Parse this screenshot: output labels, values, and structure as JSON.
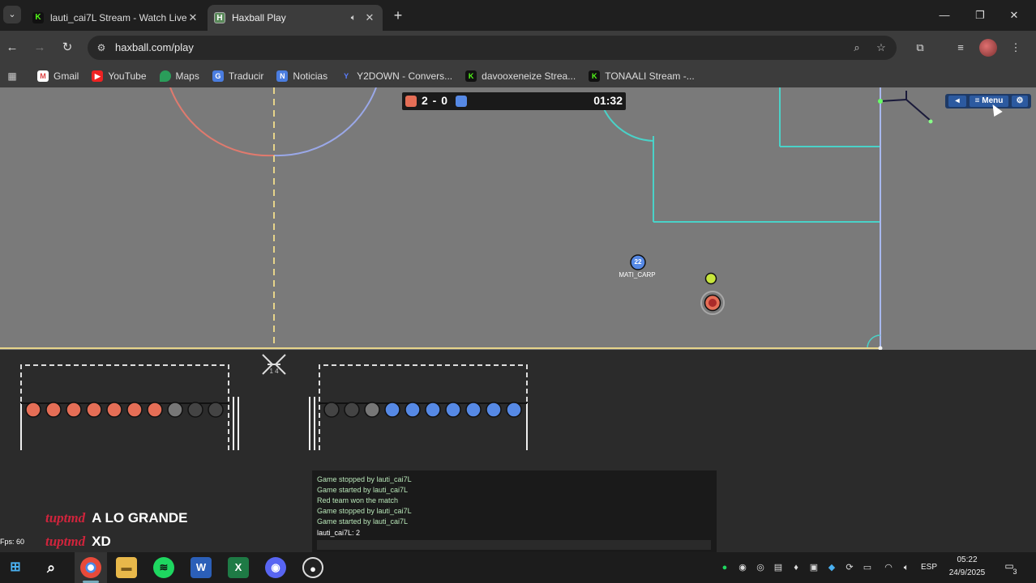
{
  "browser": {
    "tabs": [
      {
        "title": "lauti_cai7L Stream - Watch Live",
        "favicon": "K",
        "active": false
      },
      {
        "title": "Haxball Play",
        "favicon": "H",
        "active": true
      }
    ],
    "url": "haxball.com/play",
    "bookmarks": [
      {
        "label": "Gmail",
        "icon": "M"
      },
      {
        "label": "YouTube",
        "icon": "▶"
      },
      {
        "label": "Maps",
        "icon": "●"
      },
      {
        "label": "Traducir",
        "icon": "G"
      },
      {
        "label": "Noticias",
        "icon": "N"
      },
      {
        "label": "Y2DOWN - Convers...",
        "icon": "Y"
      },
      {
        "label": "davooxeneize Strea...",
        "icon": "K"
      },
      {
        "label": "TONAALI Stream -...",
        "icon": "K"
      }
    ]
  },
  "game": {
    "score": "2 - 0",
    "timer": "01:32",
    "menu_label": "≡ Menu",
    "player_name": "MATI_CARP",
    "player_number": "22",
    "goal_score_label": "1 4",
    "team_colors": {
      "red": "#e56e56",
      "blue": "#5689e5"
    },
    "fps_label": "Fps: 60"
  },
  "chat": {
    "lines": [
      "Game stopped by lauti_cai7L",
      "Game started by lauti_cai7L",
      "Red team won the match",
      "Game stopped by lauti_cai7L",
      "Game started by lauti_cai7L",
      "lauti_cai7L: 2"
    ]
  },
  "stream_overlay": [
    {
      "user": "tuptmd",
      "message": "A LO GRANDE"
    },
    {
      "user": "tuptmd",
      "message": "XD"
    }
  ],
  "taskbar": {
    "language": "ESP",
    "time": "05:22",
    "date": "24/9/2025",
    "notification_count": "3"
  }
}
